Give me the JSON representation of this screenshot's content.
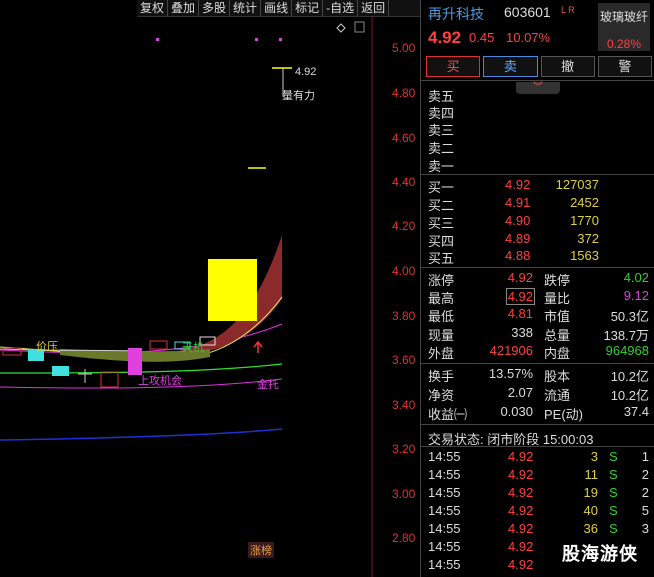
{
  "toolbar": [
    "复权",
    "叠加",
    "多股",
    "统计",
    "画线",
    "标记",
    "-自选",
    "返回"
  ],
  "chart": {
    "price_axis": [
      "5.00",
      "4.80",
      "4.60",
      "4.40",
      "4.20",
      "4.00",
      "3.80",
      "3.60",
      "3.40",
      "3.20",
      "3.00",
      "2.80"
    ],
    "annotations": {
      "price_tag": "4.92",
      "volume_tag": "量有力",
      "pressure": "价压",
      "attack": "上攻机会",
      "golden": "金托",
      "sky": "天机",
      "limit_up_list": "涨榜"
    },
    "diamond_icon": "diamond-icon"
  },
  "stock": {
    "name": "再升科技",
    "code": "603601",
    "flag": "L R",
    "price": "4.92",
    "change": "0.45",
    "pct": "10.07%",
    "sector_name": "玻璃玻纤",
    "sector_pct": "0.28%"
  },
  "trade_buttons": [
    "买",
    "卖",
    "撤",
    "警"
  ],
  "sell_levels": [
    {
      "label": "卖五",
      "price": "",
      "vol": ""
    },
    {
      "label": "卖四",
      "price": "",
      "vol": ""
    },
    {
      "label": "卖三",
      "price": "",
      "vol": ""
    },
    {
      "label": "卖二",
      "price": "",
      "vol": ""
    },
    {
      "label": "卖一",
      "price": "",
      "vol": ""
    }
  ],
  "buy_levels": [
    {
      "label": "买一",
      "price": "4.92",
      "vol": "127037"
    },
    {
      "label": "买二",
      "price": "4.91",
      "vol": "2452"
    },
    {
      "label": "买三",
      "price": "4.90",
      "vol": "1770"
    },
    {
      "label": "买四",
      "price": "4.89",
      "vol": "372"
    },
    {
      "label": "买五",
      "price": "4.88",
      "vol": "1563"
    }
  ],
  "stats": [
    {
      "l1": "涨停",
      "v1": "4.92",
      "l2": "跌停",
      "v2": "4.02"
    },
    {
      "l1": "最高",
      "v1": "4.92",
      "l2": "量比",
      "v2": "9.12"
    },
    {
      "l1": "最低",
      "v1": "4.81",
      "l2": "市值",
      "v2": "50.3亿"
    },
    {
      "l1": "现量",
      "v1": "338",
      "l2": "总量",
      "v2": "138.7万"
    },
    {
      "l1": "外盘",
      "v1": "421906",
      "l2": "内盘",
      "v2": "964968"
    }
  ],
  "stats2": [
    {
      "l1": "换手",
      "v1": "13.57%",
      "l2": "股本",
      "v2": "10.2亿"
    },
    {
      "l1": "净资",
      "v1": "2.07",
      "l2": "流通",
      "v2": "10.2亿"
    },
    {
      "l1": "收益㈠",
      "v1": "0.030",
      "l2": "PE(动)",
      "v2": "37.4"
    }
  ],
  "trade_status": "交易状态: 闭市阶段 15:00:03",
  "ticks": [
    {
      "time": "14:55",
      "price": "4.92",
      "vol": "3",
      "side": "S",
      "n": "1"
    },
    {
      "time": "14:55",
      "price": "4.92",
      "vol": "11",
      "side": "S",
      "n": "2"
    },
    {
      "time": "14:55",
      "price": "4.92",
      "vol": "19",
      "side": "S",
      "n": "2"
    },
    {
      "time": "14:55",
      "price": "4.92",
      "vol": "40",
      "side": "S",
      "n": "5"
    },
    {
      "time": "14:55",
      "price": "4.92",
      "vol": "36",
      "side": "S",
      "n": "3"
    },
    {
      "time": "14:55",
      "price": "4.92",
      "vol": "",
      "side": "",
      "n": ""
    },
    {
      "time": "14:55",
      "price": "4.92",
      "vol": "",
      "side": "",
      "n": ""
    }
  ],
  "watermark": "股海游侠"
}
